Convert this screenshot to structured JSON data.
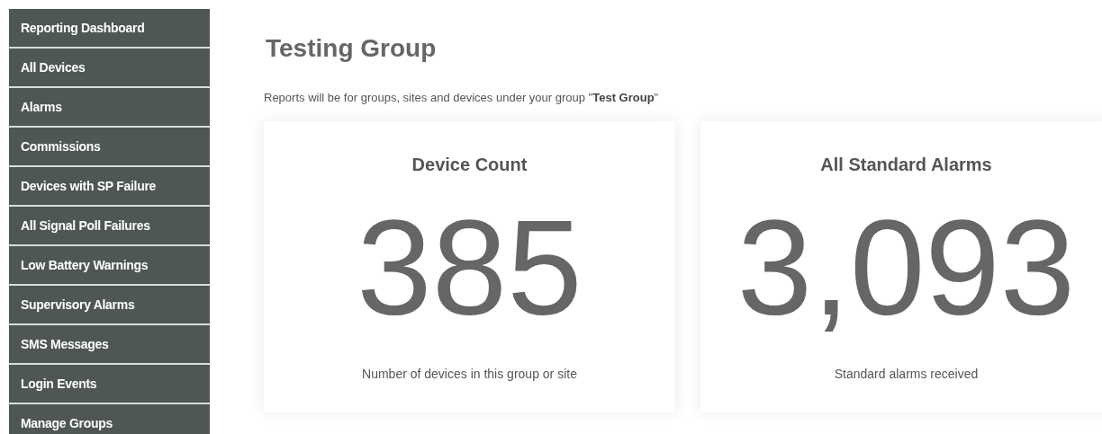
{
  "sidebar": {
    "items": [
      {
        "label": "Reporting Dashboard"
      },
      {
        "label": "All Devices"
      },
      {
        "label": "Alarms"
      },
      {
        "label": "Commissions"
      },
      {
        "label": "Devices with SP Failure"
      },
      {
        "label": "All Signal Poll Failures"
      },
      {
        "label": "Low Battery Warnings"
      },
      {
        "label": "Supervisory Alarms"
      },
      {
        "label": "SMS Messages"
      },
      {
        "label": "Login Events"
      },
      {
        "label": "Manage Groups"
      }
    ]
  },
  "page": {
    "title": "Testing Group",
    "intro": "Reports will be for groups, sites and devices under your group \"**Test Group**\""
  },
  "cards": [
    {
      "title": "Device Count",
      "value": "385",
      "caption": "Number of devices in this group or site"
    },
    {
      "title": "All Standard Alarms",
      "value": "3,093",
      "caption": "Standard alarms received"
    }
  ]
}
